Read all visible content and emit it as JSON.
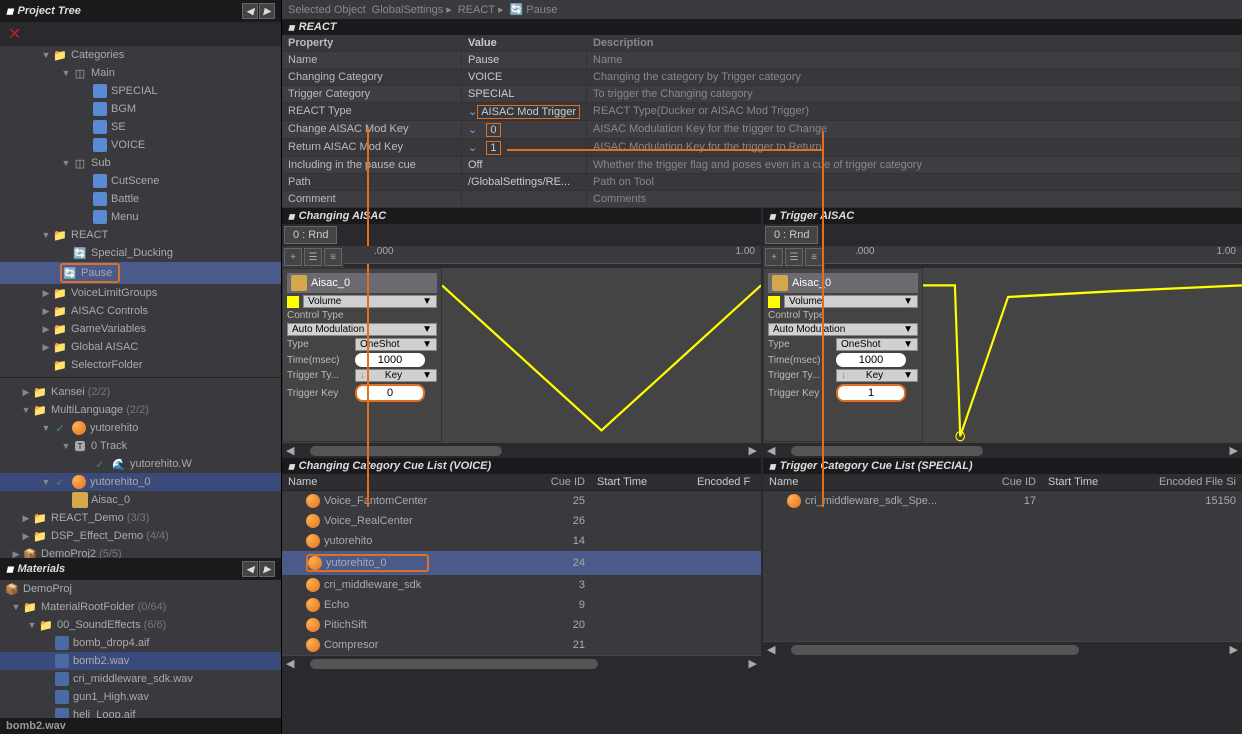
{
  "projectTree": {
    "title": "Project Tree",
    "categories": "Categories",
    "main": "Main",
    "special": "SPECIAL",
    "bgm": "BGM",
    "se": "SE",
    "voice": "VOICE",
    "sub": "Sub",
    "cutscene": "CutScene",
    "battle": "Battle",
    "menu": "Menu",
    "react": "REACT",
    "specialDucking": "Special_Ducking",
    "pause": "Pause",
    "voiceLimitGroups": "VoiceLimitGroups",
    "aisacControls": "AISAC Controls",
    "gameVariables": "GameVariables",
    "globalAisac": "Global AISAC",
    "selectorFolder": "SelectorFolder",
    "kansei": "Kansei",
    "kanseiCount": "(2/2)",
    "multiLanguage": "MultiLanguage",
    "multiLanguageCount": "(2/2)",
    "yutorehito": "yutorehito",
    "trackZero": "0   Track",
    "yutorehitoWav": "yutorehito.W",
    "yutorehito0": "yutorehito_0",
    "aisac0": "Aisac_0",
    "reactDemo": "REACT_Demo",
    "reactDemoCount": "(3/3)",
    "dspEffectDemo": "DSP_Effect_Demo",
    "dspEffectDemoCount": "(4/4)",
    "demoProj2": "DemoProj2",
    "demoProj2Count": "(5/5)"
  },
  "materials": {
    "title": "Materials",
    "demoProj": "DemoProj",
    "rootFolder": "MaterialRootFolder",
    "rootCount": "(0/64)",
    "soundEffects": "00_SoundEffects",
    "soundEffectsCount": "(6/6)",
    "bombDrop": "bomb_drop4.aif",
    "bomb2": "bomb2.wav",
    "criMw": "cri_middleware_sdk.wav",
    "gun1": "gun1_High.wav",
    "heli": "heli_Loop.aif",
    "status": "bomb2.wav"
  },
  "breadcrumb": {
    "selectedObject": "Selected Object",
    "globalSettings": "GlobalSettings",
    "react": "REACT",
    "pause": "Pause"
  },
  "reactSection": {
    "title": "REACT",
    "hProperty": "Property",
    "hValue": "Value",
    "hDescription": "Description",
    "rows": {
      "name": "Name",
      "nameVal": "Pause",
      "nameDesc": "Name",
      "chCat": "Changing Category",
      "chCatVal": "VOICE",
      "chCatDesc": "Changing the category by Trigger category",
      "trCat": "Trigger Category",
      "trCatVal": "SPECIAL",
      "trCatDesc": "To trigger the Changing category",
      "rType": "REACT Type",
      "rTypeVal": "AISAC Mod Trigger",
      "rTypeDesc": "REACT Type(Ducker or AISAC Mod Trigger)",
      "chKey": "Change AISAC Mod Key",
      "chKeyVal": "0",
      "chKeyDesc": "AISAC Modulation Key for the trigger to Change",
      "retKey": "Return AISAC Mod Key",
      "retKeyVal": "1",
      "retKeyDesc": "AISAC Modulation Key for the trigger to Return",
      "incPause": "Including in the pause cue",
      "incPauseVal": "Off",
      "incPauseDesc": "Whether the trigger flag and poses even in a cue of trigger category",
      "path": "Path",
      "pathVal": "/GlobalSettings/RE...",
      "pathDesc": "Path on Tool",
      "comment": "Comment",
      "commentVal": "",
      "commentDesc": "Comments"
    }
  },
  "aisac": {
    "changingTitle": "Changing AISAC",
    "triggerTitle": "Trigger AISAC",
    "tab": "0 : Rnd",
    "ruler000": ".000",
    "ruler100": "1.00",
    "aisacName": "Aisac_0",
    "volume": "Volume",
    "controlType": "Control Type",
    "autoMod": "Auto Modulation",
    "type": "Type",
    "oneShot": "OneShot",
    "time": "Time(msec)",
    "timeVal": "1000",
    "triggerTy": "Trigger Ty...",
    "key": "Key",
    "triggerKey": "Trigger Key",
    "triggerKeyChanging": "0",
    "triggerKeyTrigger": "1"
  },
  "cueLists": {
    "changingTitle": "Changing Category Cue List (VOICE)",
    "triggerTitle": "Trigger Category Cue List (SPECIAL)",
    "hName": "Name",
    "hCueId": "Cue ID",
    "hStart": "Start Time",
    "hEnc": "Encoded File Si",
    "hEncShort": "Encoded F",
    "changing": [
      {
        "name": "Voice_FantomCenter",
        "id": "25"
      },
      {
        "name": "Voice_RealCenter",
        "id": "26"
      },
      {
        "name": "yutorehito",
        "id": "14"
      },
      {
        "name": "yutorehito_0",
        "id": "24",
        "sel": true
      },
      {
        "name": "cri_middleware_sdk",
        "id": "3"
      },
      {
        "name": "Echo",
        "id": "9"
      },
      {
        "name": "PitichSift",
        "id": "20"
      },
      {
        "name": "Compresor",
        "id": "21"
      }
    ],
    "trigger": [
      {
        "name": "cri_middleware_sdk_Spe...",
        "id": "17",
        "enc": "15150"
      }
    ]
  }
}
